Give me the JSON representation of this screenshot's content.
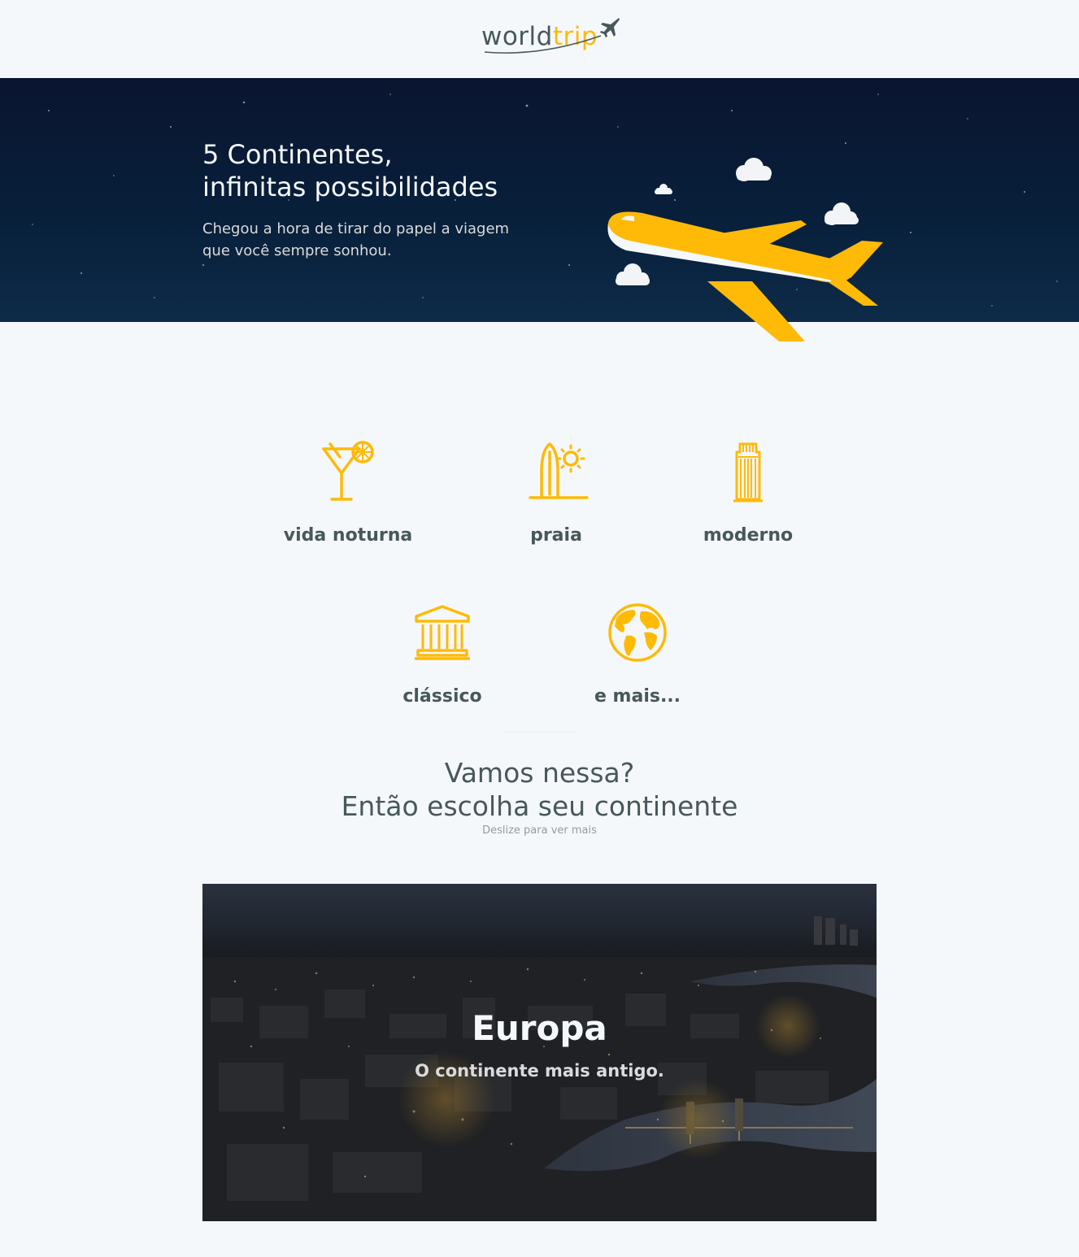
{
  "header": {
    "logo_world": "world",
    "logo_trip": "trip",
    "logo_icon": "airplane-icon"
  },
  "banner": {
    "title_line1": "5 Continentes,",
    "title_line2": "infinitas possibilidades",
    "subtitle_line1": "Chegou a hora de tirar do papel a viagem",
    "subtitle_line2": "que você sempre sonhou.",
    "illustration": "airplane-icon"
  },
  "travel_types": [
    {
      "label": "vida noturna",
      "icon": "cocktail-icon"
    },
    {
      "label": "praia",
      "icon": "surfboard-sun-icon"
    },
    {
      "label": "moderno",
      "icon": "skyscraper-icon"
    },
    {
      "label": "clássico",
      "icon": "temple-icon"
    },
    {
      "label": "e mais...",
      "icon": "globe-icon"
    }
  ],
  "cta": {
    "line1": "Vamos nessa?",
    "line2": "Então escolha seu continente",
    "hint": "Deslize para ver mais"
  },
  "slider": {
    "title": "Europa",
    "subtitle": "O continente mais antigo."
  },
  "colors": {
    "accent": "#ffba08",
    "text": "#47585b",
    "background": "#f5f8fa",
    "banner": "#08203b"
  }
}
